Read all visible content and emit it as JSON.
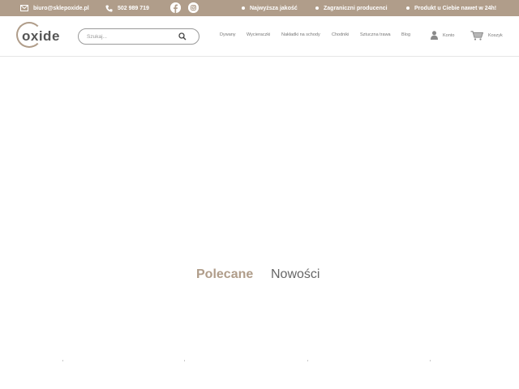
{
  "topbar": {
    "email": "biuro@sklepoxide.pl",
    "phone": "502 989 719",
    "social": [
      "facebook-icon",
      "instagram-icon"
    ],
    "badges": [
      "Najwyższa jakość",
      "Zagraniczni producenci",
      "Produkt u Ciebie nawet w 24h!"
    ]
  },
  "header": {
    "logo": "oxide",
    "search_placeholder": "Szukaj...",
    "nav": [
      "Dywany",
      "Wycieraczki",
      "Nakładki na schody",
      "Chodniki",
      "Sztuczna trawa",
      "Blog"
    ],
    "account_label": "Konto",
    "cart_label": "Koszyk"
  },
  "tabs": {
    "items": [
      "Polecane",
      "Nowości"
    ],
    "active": "Polecane"
  },
  "colors": {
    "accent": "#b09d8a",
    "text": "#555555"
  }
}
